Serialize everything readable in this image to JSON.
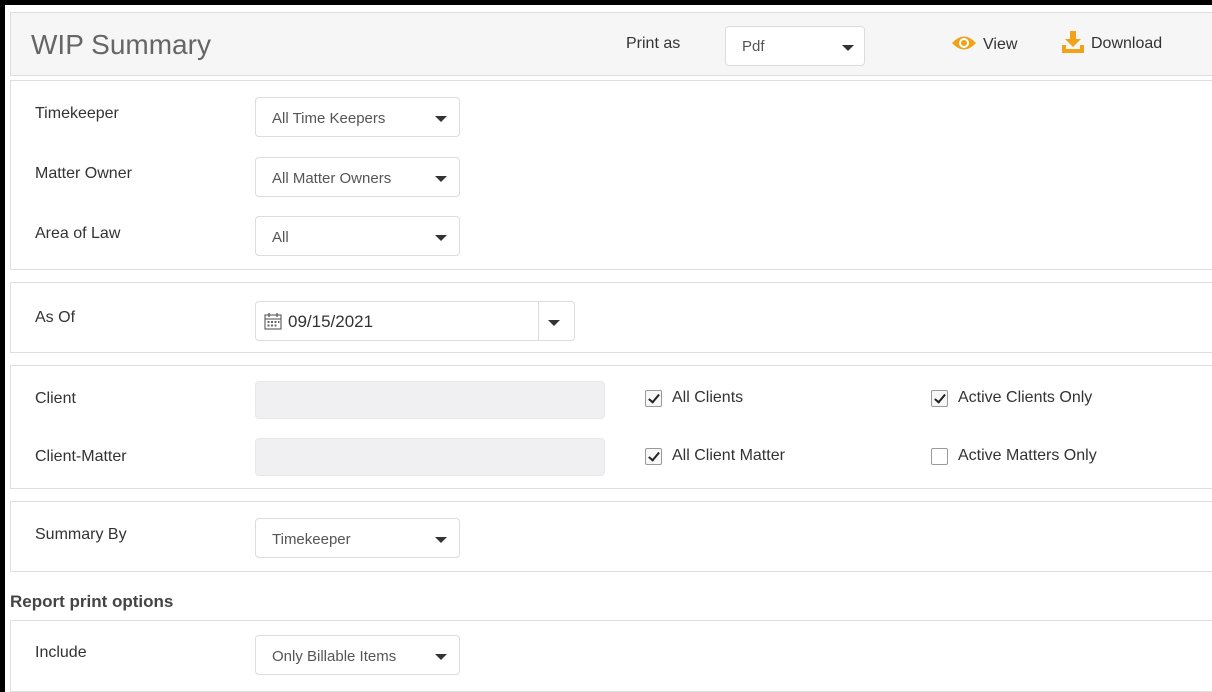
{
  "header": {
    "title": "WIP Summary",
    "print_as_label": "Print as",
    "print_as_value": "Pdf",
    "view_label": "View",
    "download_label": "Download",
    "accent_color": "#f0a31a"
  },
  "filters": {
    "timekeeper": {
      "label": "Timekeeper",
      "value": "All Time Keepers"
    },
    "matter_owner": {
      "label": "Matter Owner",
      "value": "All Matter Owners"
    },
    "area_of_law": {
      "label": "Area of Law",
      "value": "All"
    }
  },
  "as_of": {
    "label": "As Of",
    "value": "09/15/2021"
  },
  "client": {
    "label": "Client",
    "all_clients": {
      "label": "All Clients",
      "checked": true
    },
    "active_clients_only": {
      "label": "Active Clients Only",
      "checked": true
    }
  },
  "client_matter": {
    "label": "Client-Matter",
    "all_client_matter": {
      "label": "All Client Matter",
      "checked": true
    },
    "active_matters_only": {
      "label": "Active Matters Only",
      "checked": false
    }
  },
  "summary_by": {
    "label": "Summary By",
    "value": "Timekeeper"
  },
  "report_print_options": {
    "heading": "Report print options",
    "include": {
      "label": "Include",
      "value": "Only Billable Items"
    }
  }
}
